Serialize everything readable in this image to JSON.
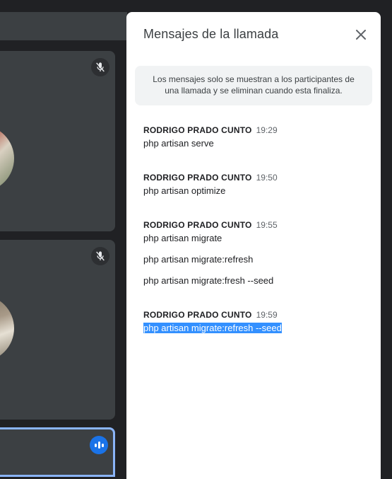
{
  "panel": {
    "title": "Mensajes de la llamada",
    "notice": "Los mensajes solo se muestran a los participantes de una llamada y se eliminan cuando esta finaliza."
  },
  "messages": [
    {
      "sender": "RODRIGO PRADO CUNTO",
      "time": "19:29",
      "lines": [
        "php artisan serve"
      ]
    },
    {
      "sender": "RODRIGO PRADO CUNTO",
      "time": "19:50",
      "lines": [
        "php artisan optimize"
      ]
    },
    {
      "sender": "RODRIGO PRADO CUNTO",
      "time": "19:55",
      "lines": [
        "php artisan migrate",
        "php artisan migrate:refresh",
        "php artisan migrate:fresh --seed"
      ]
    },
    {
      "sender": "RODRIGO PRADO CUNTO",
      "time": "19:59",
      "lines": [
        "php artisan migrate:refresh --seed"
      ]
    }
  ],
  "icons": {
    "close": "close-icon",
    "mic_off": "mic-off-icon",
    "speaking": "speaking-indicator-icon"
  },
  "colors": {
    "background": "#202124",
    "tile": "#3c4043",
    "accent": "#1a73e8",
    "active_border": "#8ab4f8",
    "selection": "#3390ff"
  }
}
